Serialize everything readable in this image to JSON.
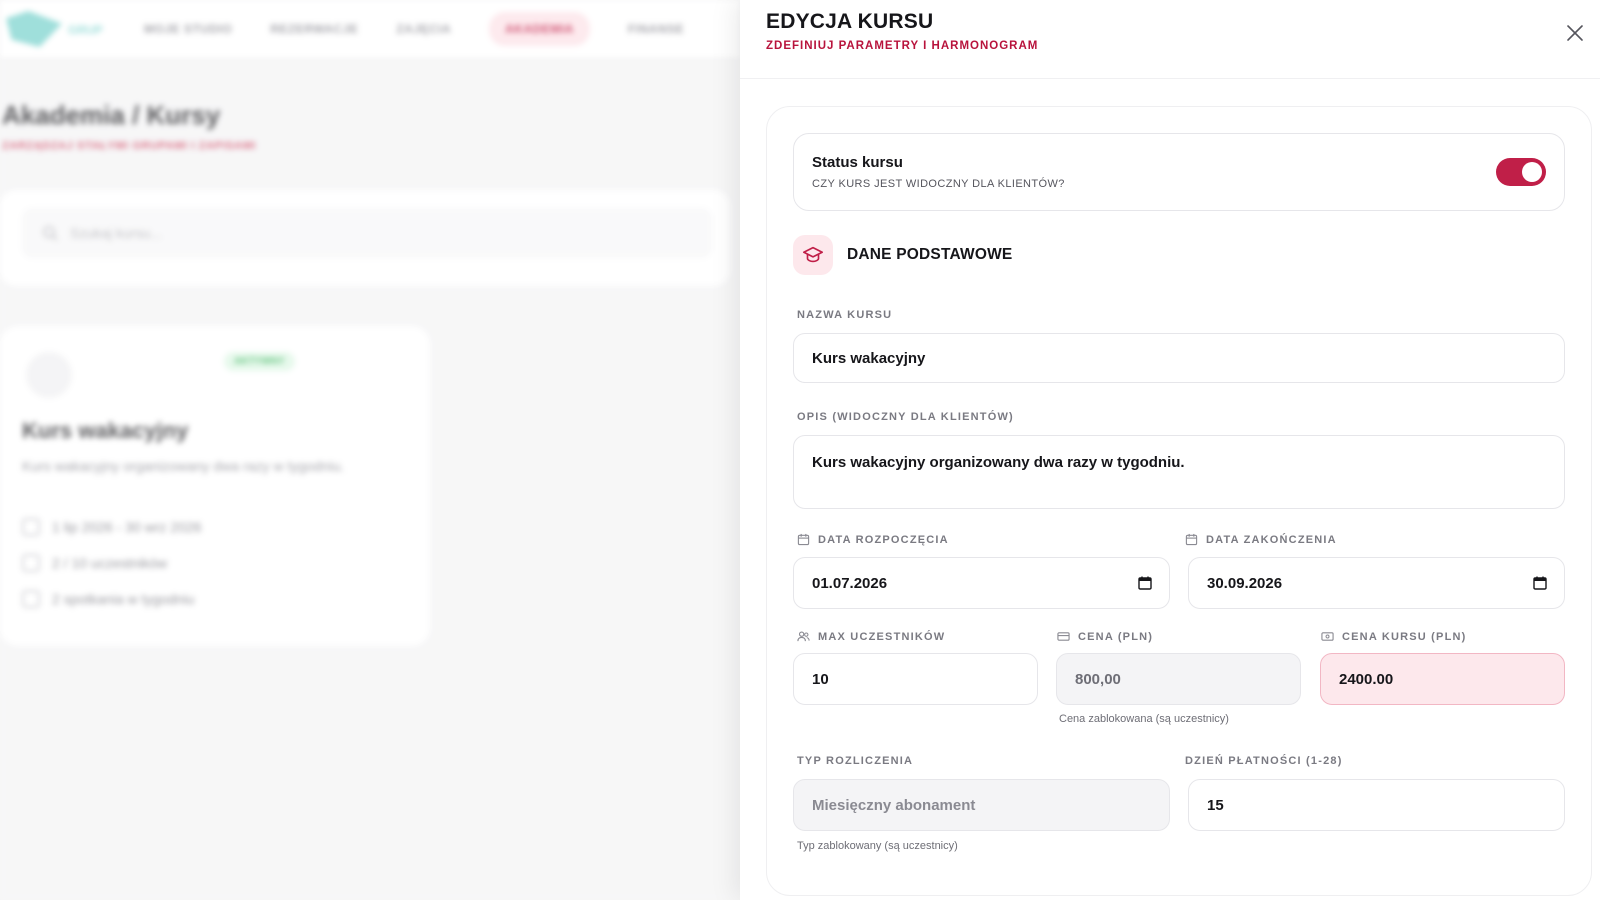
{
  "background": {
    "logo_text": "GRUP",
    "nav": [
      "MOJE STUDIO",
      "REZERWACJE",
      "ZAJĘCIA",
      "AKADEMIA",
      "FINANSE"
    ],
    "page_title": "Akademia / Kursy",
    "page_subtitle": "ZARZĄDZAJ STAŁYMI GRUPAMI I ZAPISAMI",
    "search_placeholder": "Szukaj kursu...",
    "card": {
      "badge": "AKTYWNY",
      "name": "Kurs wakacyjny",
      "description": "Kurs wakacyjny organizowany dwa razy w tygodniu.",
      "dates": "1 lip 2026 - 30 wrz 2026",
      "participants": "2 / 10 uczestników",
      "frequency": "2 spotkania w tygodniu"
    }
  },
  "drawer": {
    "title": "EDYCJA KURSU",
    "subtitle": "ZDEFINIUJ PARAMETRY I HARMONOGRAM",
    "status": {
      "title": "Status kursu",
      "description": "CZY KURS JEST WIDOCZNY DLA KLIENTÓW?",
      "enabled": true
    },
    "section_title": "DANE PODSTAWOWE",
    "fields": {
      "name_label": "NAZWA KURSU",
      "name_value": "Kurs wakacyjny",
      "description_label": "OPIS (WIDOCZNY DLA KLIENTÓW)",
      "description_value": "Kurs wakacyjny organizowany dwa razy w tygodniu.",
      "start_label": "DATA ROZPOCZĘCIA",
      "start_value": "01.07.2026",
      "end_label": "DATA ZAKOŃCZENIA",
      "end_value": "30.09.2026",
      "max_label": "MAX UCZESTNIKÓW",
      "max_value": "10",
      "price_label": "CENA (PLN)",
      "price_value": "800,00",
      "price_hint": "Cena zablokowana (są uczestnicy)",
      "total_label": "CENA KURSU (PLN)",
      "total_value": "2400.00",
      "billing_label": "TYP ROZLICZENIA",
      "billing_value": "Miesięczny abonament",
      "billing_hint": "Typ zablokowany (są uczestnicy)",
      "payday_label": "DZIEŃ PŁATNOŚCI (1-28)",
      "payday_value": "15"
    }
  },
  "colors": {
    "accent": "#c01f48",
    "accent_light": "#fde8ec"
  }
}
